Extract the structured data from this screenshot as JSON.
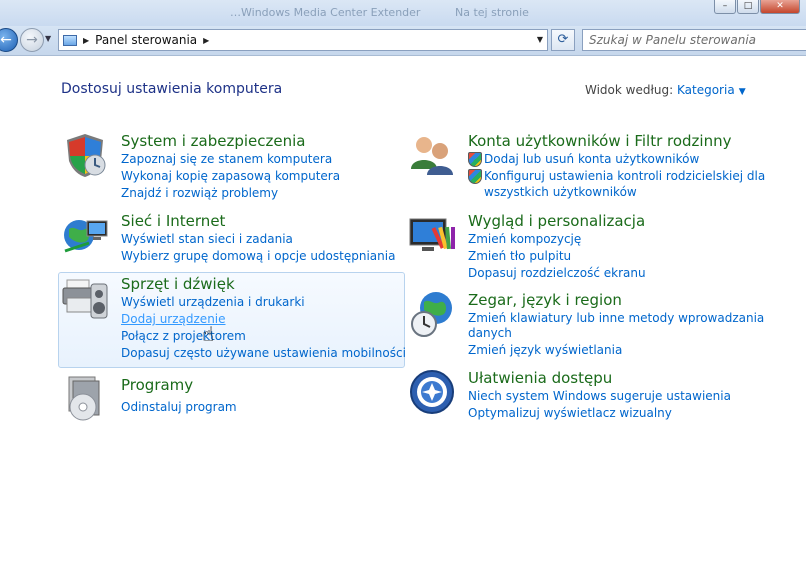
{
  "window": {
    "ghost_title_left": "…Windows Media Center Extender",
    "ghost_title_right": "Na tej stronie",
    "controls": [
      "–",
      "□",
      "✕"
    ]
  },
  "toolbar": {
    "address": "Panel sterowania",
    "search_placeholder": "Szukaj w Panelu sterowania"
  },
  "header": {
    "title": "Dostosuj ustawienia komputera",
    "view_by_label": "Widok według:",
    "view_by_value": "Kategoria"
  },
  "categories": [
    {
      "title": "System i zabezpieczenia",
      "icon": "shield-icon",
      "links": [
        "Zapoznaj się ze stanem komputera",
        "Wykonaj kopię zapasową komputera",
        "Znajdź i rozwiąż problemy"
      ]
    },
    {
      "title": "Sieć i Internet",
      "icon": "network-globe-icon",
      "links": [
        "Wyświetl stan sieci i zadania",
        "Wybierz grupę domową i opcje udostępniania"
      ]
    },
    {
      "title": "Sprzęt i dźwięk",
      "icon": "printer-speaker-icon",
      "links": [
        "Wyświetl urządzenia i drukarki",
        "Dodaj urządzenie",
        "Połącz z projektorem",
        "Dopasuj często używane ustawienia mobilności"
      ]
    },
    {
      "title": "Programy",
      "icon": "programs-disc-icon",
      "links": [
        "Odinstaluj program"
      ]
    },
    {
      "title": "Konta użytkowników i Filtr rodzinny",
      "icon": "users-icon",
      "links": [
        "Dodaj lub usuń konta użytkowników",
        "Konfiguruj ustawienia kontroli rodzicielskiej dla",
        "wszystkich użytkowników"
      ]
    },
    {
      "title": "Wygląd i personalizacja",
      "icon": "monitor-palette-icon",
      "links": [
        "Zmień kompozycję",
        "Zmień tło pulpitu",
        "Dopasuj rozdzielczość ekranu"
      ]
    },
    {
      "title": "Zegar, język i region",
      "icon": "clock-globe-icon",
      "links": [
        "Zmień klawiatury lub inne metody wprowadzania",
        "danych",
        "Zmień język wyświetlania"
      ]
    },
    {
      "title": "Ułatwienia dostępu",
      "icon": "accessibility-icon",
      "links": [
        "Niech system Windows sugeruje ustawienia",
        "Optymalizuj wyświetlacz wizualny"
      ]
    }
  ],
  "colors": {
    "category_title": "#1b6b1b",
    "link": "#0066cc",
    "heading": "#1e3287"
  }
}
